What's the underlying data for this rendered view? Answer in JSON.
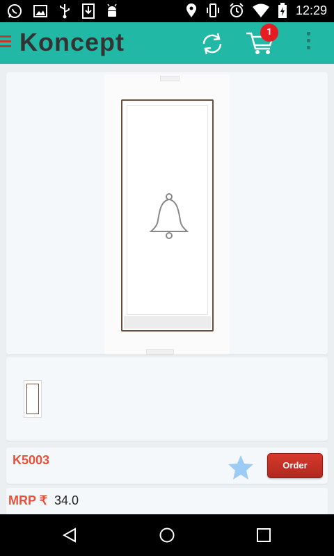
{
  "status_bar": {
    "time": "12:29",
    "left_icons": [
      "whatsapp-icon",
      "image-icon",
      "usb-icon",
      "download-icon",
      "android-icon"
    ],
    "right_icons": [
      "location-icon",
      "vibrate-icon",
      "alarm-icon",
      "wifi-icon",
      "battery-icon"
    ]
  },
  "app_bar": {
    "logo_text": "Koncept",
    "cart_count": "1",
    "icons": [
      "menu-icon",
      "refresh-icon",
      "cart-icon",
      "overflow-menu-icon"
    ]
  },
  "product": {
    "code": "K5003",
    "order_label": "Order",
    "mrp_label": "MRP ₹",
    "mrp_value": "34.0",
    "image_icon": "bell-icon"
  },
  "nav_bar": {
    "icons": [
      "back-icon",
      "home-icon",
      "recents-icon"
    ]
  },
  "colors": {
    "app_bar": "#21b9a5",
    "accent_red": "#e8503a",
    "order_button": "#c5302a",
    "badge": "#e51c23"
  }
}
